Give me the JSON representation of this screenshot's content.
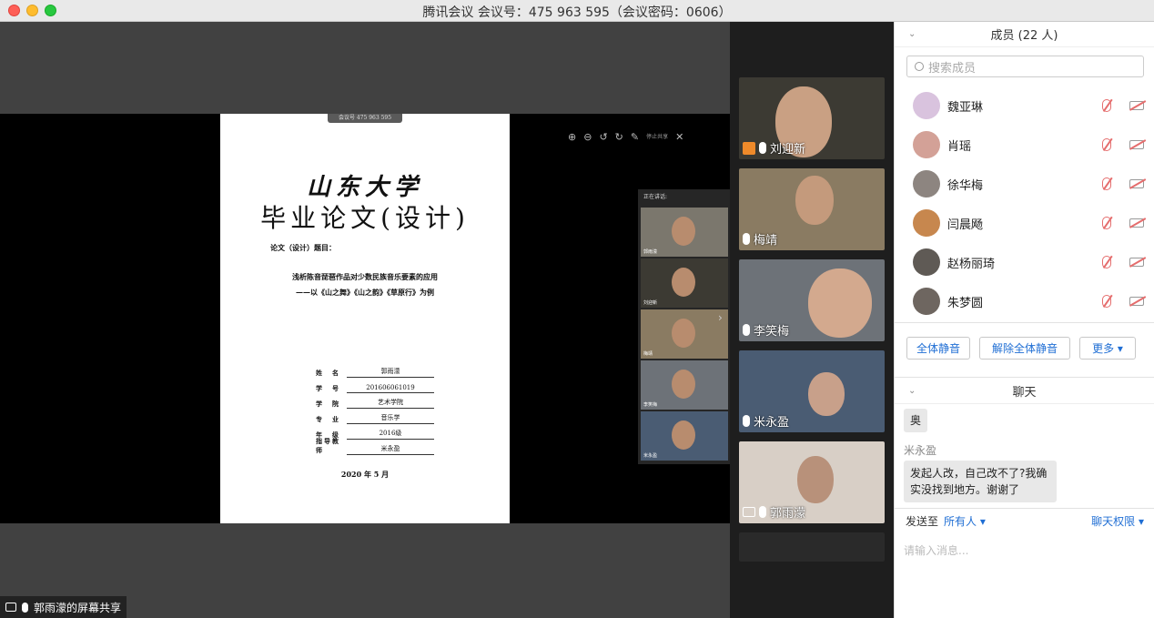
{
  "window": {
    "title": "腾讯会议 会议号：475 963 595（会议密码：0606）"
  },
  "share": {
    "meeting_badge": "会议号 475 963 595",
    "status_text": "郭雨濛的屏幕共享",
    "toolbar_stop": "停止共享",
    "speaking_label": "正在讲话:",
    "mini_tiles": [
      "郭雨濛",
      "刘迎新",
      "梅靖",
      "李笑梅",
      "米永盈"
    ]
  },
  "document": {
    "university": "山东大学",
    "thesis_title": "毕业论文(设计)",
    "topic_label": "论文（设计）题目：",
    "topic_line1": "浅析陈音琵琶作品对少数民族音乐要素的应用",
    "topic_line2": "——以《山之舞》《山之韵》《草原行》为例",
    "fields": [
      {
        "key": "姓　名",
        "value": "郭雨濛"
      },
      {
        "key": "学　号",
        "value": "201606061019"
      },
      {
        "key": "学　院",
        "value": "艺术学院"
      },
      {
        "key": "专　业",
        "value": "音乐学"
      },
      {
        "key": "年　级",
        "value": "2016级"
      },
      {
        "key": "指导教师",
        "value": "米永盈"
      }
    ],
    "date": "2020 年 5 月"
  },
  "videos": [
    {
      "name": "刘迎新",
      "bg": "#3c3a33",
      "face": "#c9a083",
      "has_avatar_icon": true
    },
    {
      "name": "梅靖",
      "bg": "#8a7b62",
      "face": "#c49a7c",
      "has_avatar_icon": false
    },
    {
      "name": "李笑梅",
      "bg": "#6d7278",
      "face": "#d3a98e",
      "has_avatar_icon": false
    },
    {
      "name": "米永盈",
      "bg": "#4a5c73",
      "face": "#c8a08a",
      "has_avatar_icon": false
    },
    {
      "name": "郭雨濛",
      "bg": "#d8cfc6",
      "face": "#b8917a",
      "has_avatar_icon": false,
      "sharing": true
    }
  ],
  "members": {
    "header": "成员 (22 人)",
    "search_placeholder": "搜索成员",
    "list": [
      {
        "name": "魏亚琳",
        "avatar_color": "#d9c3de"
      },
      {
        "name": "肖瑶",
        "avatar_color": "#d3a197"
      },
      {
        "name": "徐华梅",
        "avatar_color": "#8d8580"
      },
      {
        "name": "闫晨飏",
        "avatar_color": "#c7874e"
      },
      {
        "name": "赵杨丽琦",
        "avatar_color": "#5f5a55"
      },
      {
        "name": "朱梦圆",
        "avatar_color": "#6e6660"
      }
    ],
    "buttons": {
      "mute_all": "全体静音",
      "unmute_all": "解除全体静音",
      "more": "更多 ▾"
    }
  },
  "chat": {
    "header": "聊天",
    "message_partial": "奥",
    "sender": "米永盈",
    "message": "发起人改，自己改不了?我确实没找到地方。谢谢了",
    "send_to_label": "发送至",
    "send_to_value": "所有人 ▾",
    "permission": "聊天权限 ▾",
    "input_placeholder": "请输入消息..."
  }
}
